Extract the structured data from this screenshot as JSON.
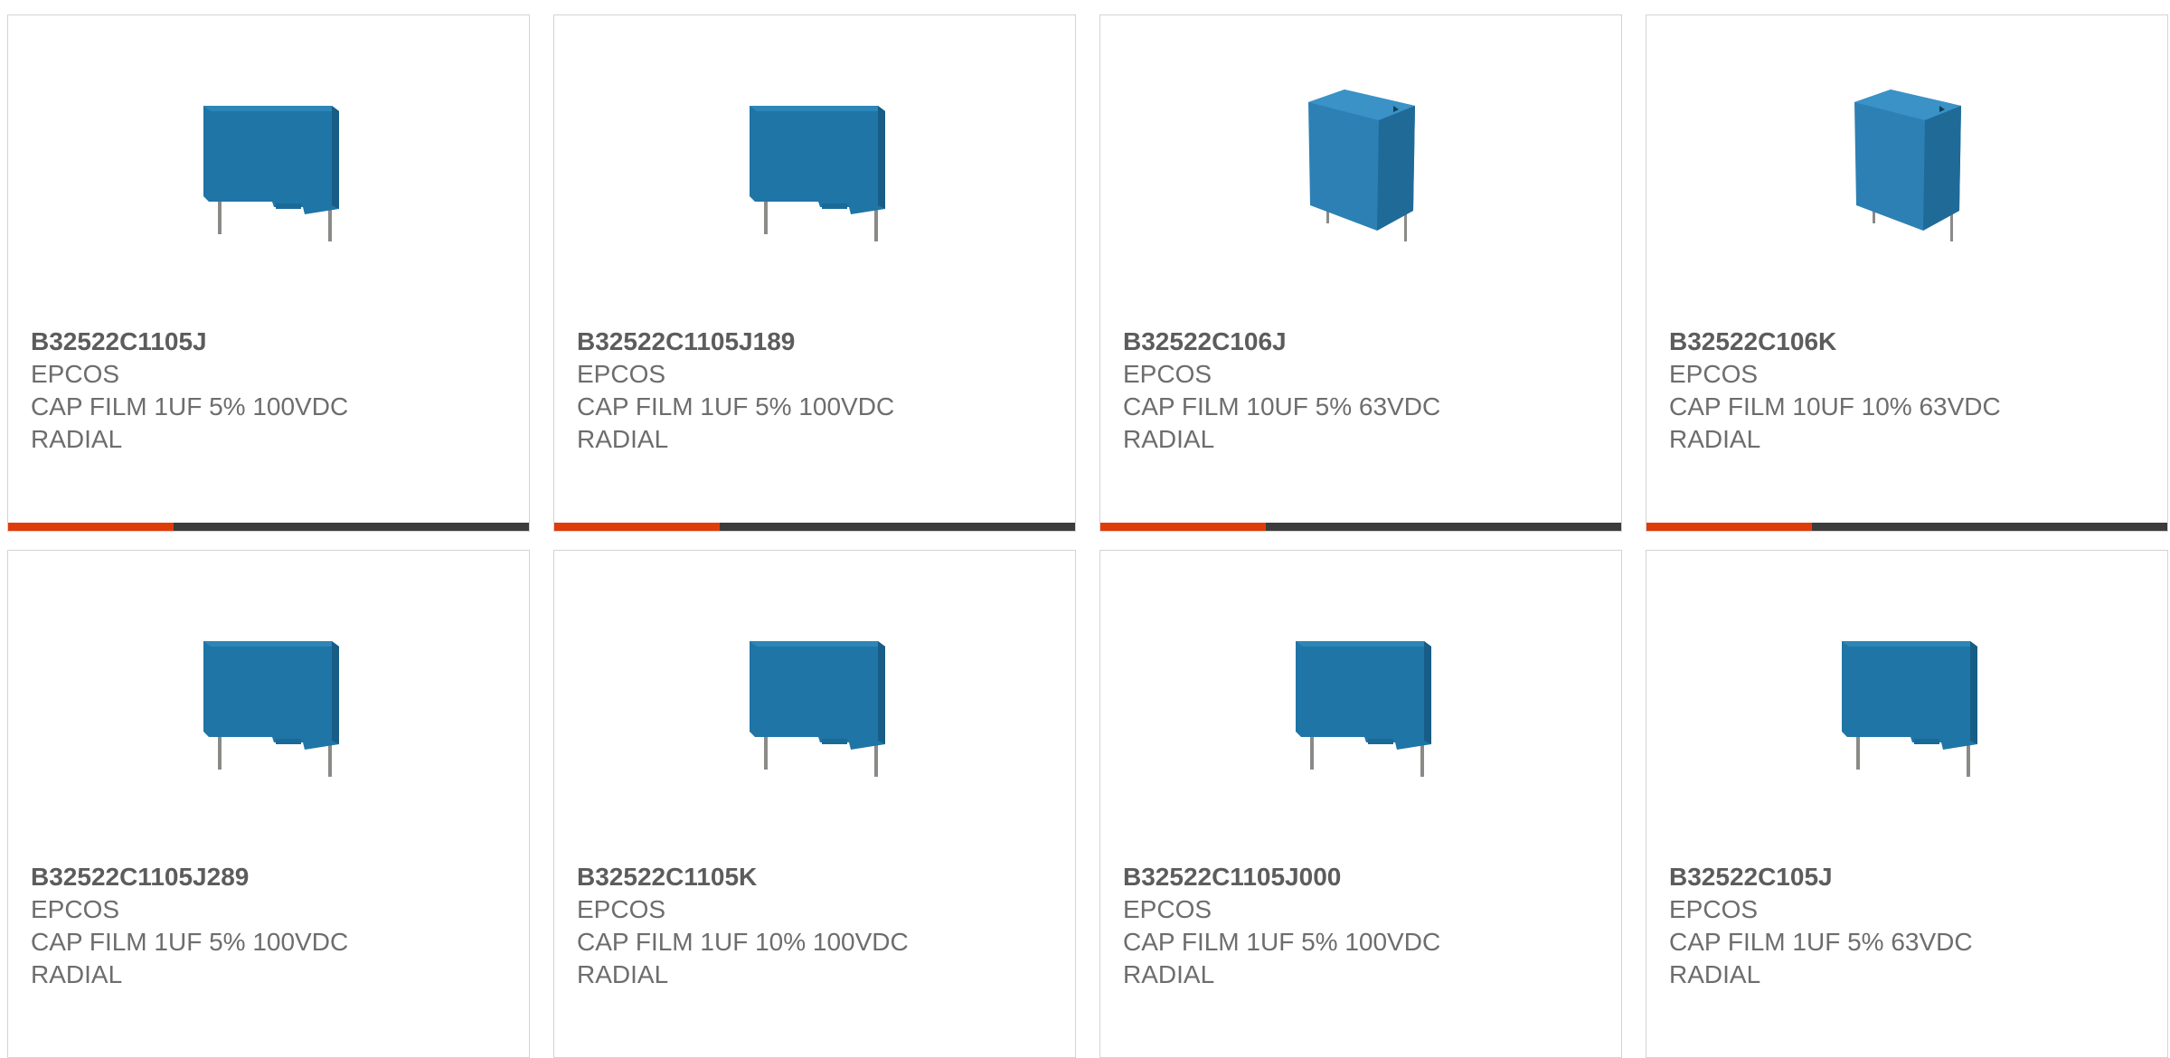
{
  "colors": {
    "accent": "#e03c0a",
    "bar_track": "#3c3c3c",
    "capacitor_body": "#1f77a8",
    "text": "#6d6d6d"
  },
  "products": [
    {
      "part": "B32522C1105J",
      "brand": "EPCOS",
      "desc": "CAP FILM 1UF 5% 100VDC",
      "mount": "RADIAL",
      "image": "capacitor-wide-icon"
    },
    {
      "part": "B32522C1105J189",
      "brand": "EPCOS",
      "desc": "CAP FILM 1UF 5% 100VDC",
      "mount": "RADIAL",
      "image": "capacitor-wide-icon"
    },
    {
      "part": "B32522C106J",
      "brand": "EPCOS",
      "desc": "CAP FILM 10UF 5% 63VDC",
      "mount": "RADIAL",
      "image": "capacitor-angled-icon"
    },
    {
      "part": "B32522C106K",
      "brand": "EPCOS",
      "desc": "CAP FILM 10UF 10% 63VDC",
      "mount": "RADIAL",
      "image": "capacitor-angled-icon"
    },
    {
      "part": "B32522C1105J289",
      "brand": "EPCOS",
      "desc": "CAP FILM 1UF 5% 100VDC",
      "mount": "RADIAL",
      "image": "capacitor-wide-icon"
    },
    {
      "part": "B32522C1105K",
      "brand": "EPCOS",
      "desc": "CAP FILM 1UF 10% 100VDC",
      "mount": "RADIAL",
      "image": "capacitor-wide-icon"
    },
    {
      "part": "B32522C1105J000",
      "brand": "EPCOS",
      "desc": "CAP FILM 1UF 5% 100VDC",
      "mount": "RADIAL",
      "image": "capacitor-wide-icon"
    },
    {
      "part": "B32522C105J",
      "brand": "EPCOS",
      "desc": "CAP FILM 1UF 5% 63VDC",
      "mount": "RADIAL",
      "image": "capacitor-wide-icon"
    }
  ]
}
